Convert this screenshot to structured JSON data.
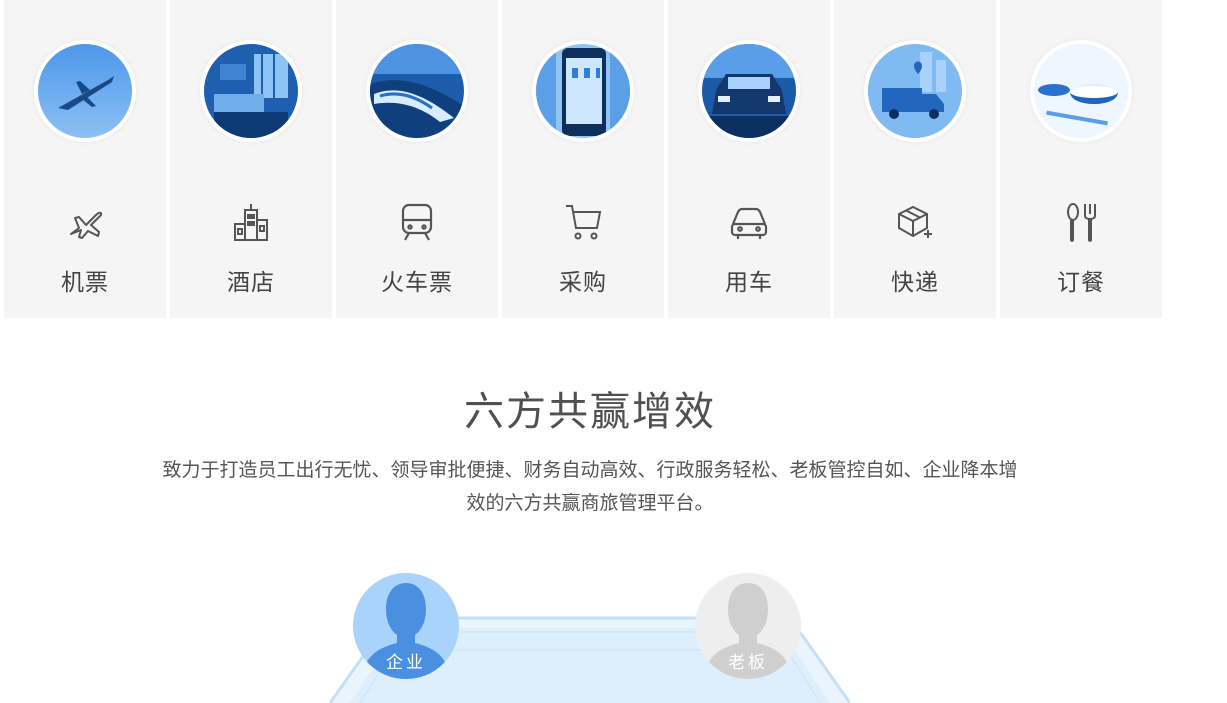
{
  "services": [
    {
      "label": "机票",
      "icon": "airplane-icon"
    },
    {
      "label": "酒店",
      "icon": "building-icon"
    },
    {
      "label": "火车票",
      "icon": "train-icon"
    },
    {
      "label": "采购",
      "icon": "cart-icon"
    },
    {
      "label": "用车",
      "icon": "car-icon"
    },
    {
      "label": "快递",
      "icon": "package-icon"
    },
    {
      "label": "订餐",
      "icon": "cutlery-icon"
    }
  ],
  "section": {
    "title": "六方共赢增效",
    "desc_line1": "致力于打造员工出行无忧、领导审批便捷、财务自动高效、行政服务轻松、老板管控自如、企业降本增",
    "desc_line2": "效的六方共赢商旅管理平台。"
  },
  "roles": {
    "enterprise": "企业",
    "boss": "老板"
  },
  "colors": {
    "tile_bg": "#f5f5f5",
    "photo_blue": "#2d7ee0",
    "icon_gray": "#555555",
    "enterprise_avatar": "#4a8fe0",
    "boss_avatar": "#cfcfcf"
  }
}
